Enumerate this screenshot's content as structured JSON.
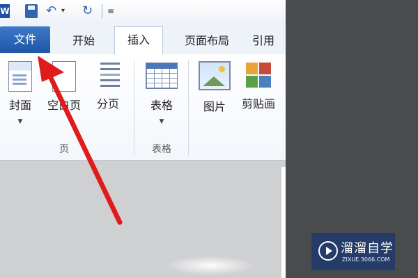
{
  "quick_access": {
    "app_icon_label": "W",
    "icons": [
      "save-icon",
      "undo-icon",
      "redo-icon",
      "customize-icon"
    ]
  },
  "tabs": [
    {
      "label": "文件",
      "active": false
    },
    {
      "label": "开始",
      "active": false
    },
    {
      "label": "插入",
      "active": true
    },
    {
      "label": "页面布局",
      "active": false
    },
    {
      "label": "引用",
      "active": false
    }
  ],
  "ribbon": {
    "buttons": {
      "cover": "封面",
      "blank_page": "空白页",
      "page_break": "分页",
      "table": "表格",
      "picture": "图片",
      "clip_art": "剪贴画"
    },
    "groups": {
      "pages": "页",
      "tables": "表格"
    }
  },
  "watermark": {
    "brand": "溜溜自学",
    "url": "ZIXUE.3066.COM"
  },
  "colors": {
    "file_tab": "#2f66b3",
    "arrow": "#e01b1b",
    "side_panel": "#4a4b4d"
  }
}
